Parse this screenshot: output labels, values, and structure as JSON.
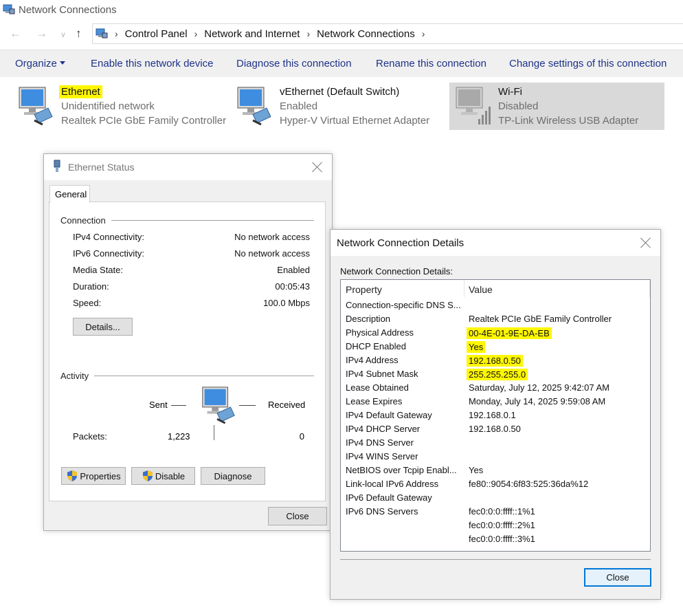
{
  "window": {
    "title": "Network Connections"
  },
  "breadcrumb": {
    "items": [
      "Control Panel",
      "Network and Internet",
      "Network Connections"
    ]
  },
  "commandbar": {
    "organize": "Organize",
    "enable": "Enable this network device",
    "diagnose": "Diagnose this connection",
    "rename": "Rename this connection",
    "change": "Change settings of this connection"
  },
  "adapters": [
    {
      "name": "Ethernet",
      "status": "Unidentified network",
      "device": "Realtek PCIe GbE Family Controller"
    },
    {
      "name": "vEthernet (Default Switch)",
      "status": "Enabled",
      "device": "Hyper-V Virtual Ethernet Adapter"
    },
    {
      "name": "Wi-Fi",
      "status": "Disabled",
      "device": "TP-Link Wireless USB Adapter"
    }
  ],
  "status_dialog": {
    "title": "Ethernet Status",
    "tab": "General",
    "connection_label": "Connection",
    "rows": [
      {
        "key": "IPv4 Connectivity:",
        "value": "No network access"
      },
      {
        "key": "IPv6 Connectivity:",
        "value": "No network access"
      },
      {
        "key": "Media State:",
        "value": "Enabled"
      },
      {
        "key": "Duration:",
        "value": "00:05:43"
      },
      {
        "key": "Speed:",
        "value": "100.0 Mbps"
      }
    ],
    "details_button": "Details...",
    "activity_label": "Activity",
    "sent_label": "Sent",
    "received_label": "Received",
    "packets_label": "Packets:",
    "packets_sent": "1,223",
    "packets_received": "0",
    "properties_button": "Properties",
    "disable_button": "Disable",
    "diagnose_button": "Diagnose",
    "close_button": "Close"
  },
  "details_dialog": {
    "title": "Network Connection Details",
    "label": "Network Connection Details:",
    "col_property": "Property",
    "col_value": "Value",
    "rows": [
      {
        "property": "Connection-specific DNS S...",
        "value": ""
      },
      {
        "property": "Description",
        "value": "Realtek PCIe GbE Family Controller"
      },
      {
        "property": "Physical Address",
        "value": "00-4E-01-9E-DA-EB"
      },
      {
        "property": "DHCP Enabled",
        "value": "Yes"
      },
      {
        "property": "IPv4 Address",
        "value": "192.168.0.50"
      },
      {
        "property": "IPv4 Subnet Mask",
        "value": "255.255.255.0"
      },
      {
        "property": "Lease Obtained",
        "value": "Saturday, July 12, 2025 9:42:07 AM"
      },
      {
        "property": "Lease Expires",
        "value": "Monday, July 14, 2025 9:59:08 AM"
      },
      {
        "property": "IPv4 Default Gateway",
        "value": "192.168.0.1"
      },
      {
        "property": "IPv4 DHCP Server",
        "value": "192.168.0.50"
      },
      {
        "property": "IPv4 DNS Server",
        "value": ""
      },
      {
        "property": "IPv4 WINS Server",
        "value": ""
      },
      {
        "property": "NetBIOS over Tcpip Enabl...",
        "value": "Yes"
      },
      {
        "property": "Link-local IPv6 Address",
        "value": "fe80::9054:6f83:525:36da%12"
      },
      {
        "property": "IPv6 Default Gateway",
        "value": ""
      },
      {
        "property": "IPv6 DNS Servers",
        "value": "fec0:0:0:ffff::1%1"
      },
      {
        "property": "",
        "value": "fec0:0:0:ffff::2%1"
      },
      {
        "property": "",
        "value": "fec0:0:0:ffff::3%1"
      }
    ],
    "close_button": "Close"
  },
  "icons": {
    "app": "network-connections-icon",
    "adapter_wired": "wired-adapter-icon",
    "adapter_wifi": "wifi-adapter-icon",
    "shield": "uac-shield-icon"
  },
  "colors": {
    "highlight": "#fff700",
    "link_blue": "#1e3287",
    "selected_bg": "#d9d9d9"
  }
}
